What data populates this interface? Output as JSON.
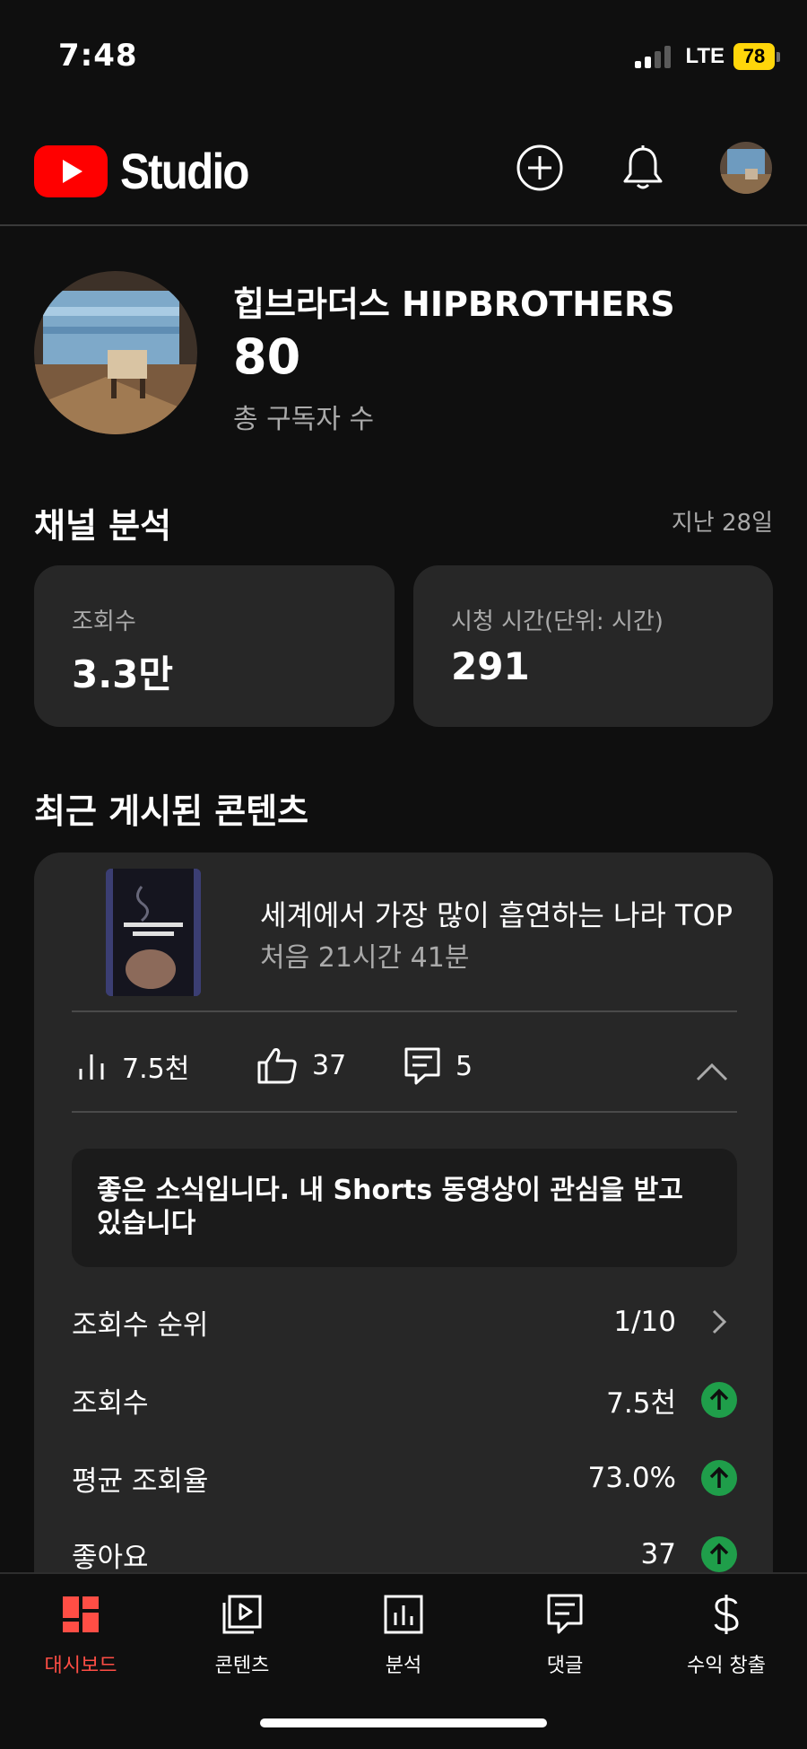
{
  "status_bar": {
    "time": "7:48",
    "network": "LTE",
    "battery": "78",
    "battery_color": "#ffd60a"
  },
  "header": {
    "logo_text": "Studio",
    "brand_color": "#ff0000",
    "icons": [
      "create-icon",
      "bell-icon"
    ]
  },
  "channel": {
    "name": "힙브라더스 HIPBROTHERS",
    "subscriber_count": "80",
    "subscriber_label": "총 구독자 수"
  },
  "analytics": {
    "title": "채널 분석",
    "period": "지난 28일",
    "cards": [
      {
        "label": "조회수",
        "value": "3.3만"
      },
      {
        "label": "시청 시간(단위: 시간)",
        "value": "291"
      }
    ]
  },
  "recent": {
    "title": "최근 게시된 콘텐츠",
    "video": {
      "title": "세계에서 가장 많이 흡연하는 나라 TOP",
      "age": "처음 21시간 41분",
      "views": "7.5천",
      "likes": "37",
      "comments": "5"
    },
    "news": "좋은 소식입니다. 내 Shorts 동영상이 관심을 받고 있습니다",
    "stats": [
      {
        "label": "조회수 순위",
        "value": "1/10",
        "icon": "chevron-right-icon"
      },
      {
        "label": "조회수",
        "value": "7.5천",
        "icon": "arrow-up-icon"
      },
      {
        "label": "평균 조회율",
        "value": "73.0%",
        "icon": "arrow-up-icon"
      },
      {
        "label": "좋아요",
        "value": "37",
        "icon": "arrow-up-icon"
      }
    ],
    "trend_color": "#1f9e4a"
  },
  "nav": {
    "active_color": "#ff4e45",
    "items": [
      {
        "label": "대시보드",
        "icon": "dashboard-icon"
      },
      {
        "label": "콘텐츠",
        "icon": "content-icon"
      },
      {
        "label": "분석",
        "icon": "analytics-icon"
      },
      {
        "label": "댓글",
        "icon": "comments-icon"
      },
      {
        "label": "수익 창출",
        "icon": "dollar-icon"
      }
    ]
  }
}
